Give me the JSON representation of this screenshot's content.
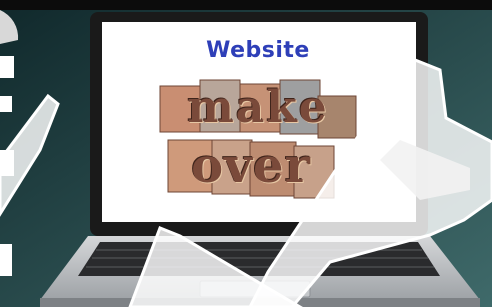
{
  "screen": {
    "headline": "Website",
    "word1": "make",
    "word2": "over"
  },
  "colors": {
    "background": "#1f3a3c",
    "headline": "#2e3fb8",
    "laptop": "#b9bcbf",
    "screen": "#ffffff"
  }
}
